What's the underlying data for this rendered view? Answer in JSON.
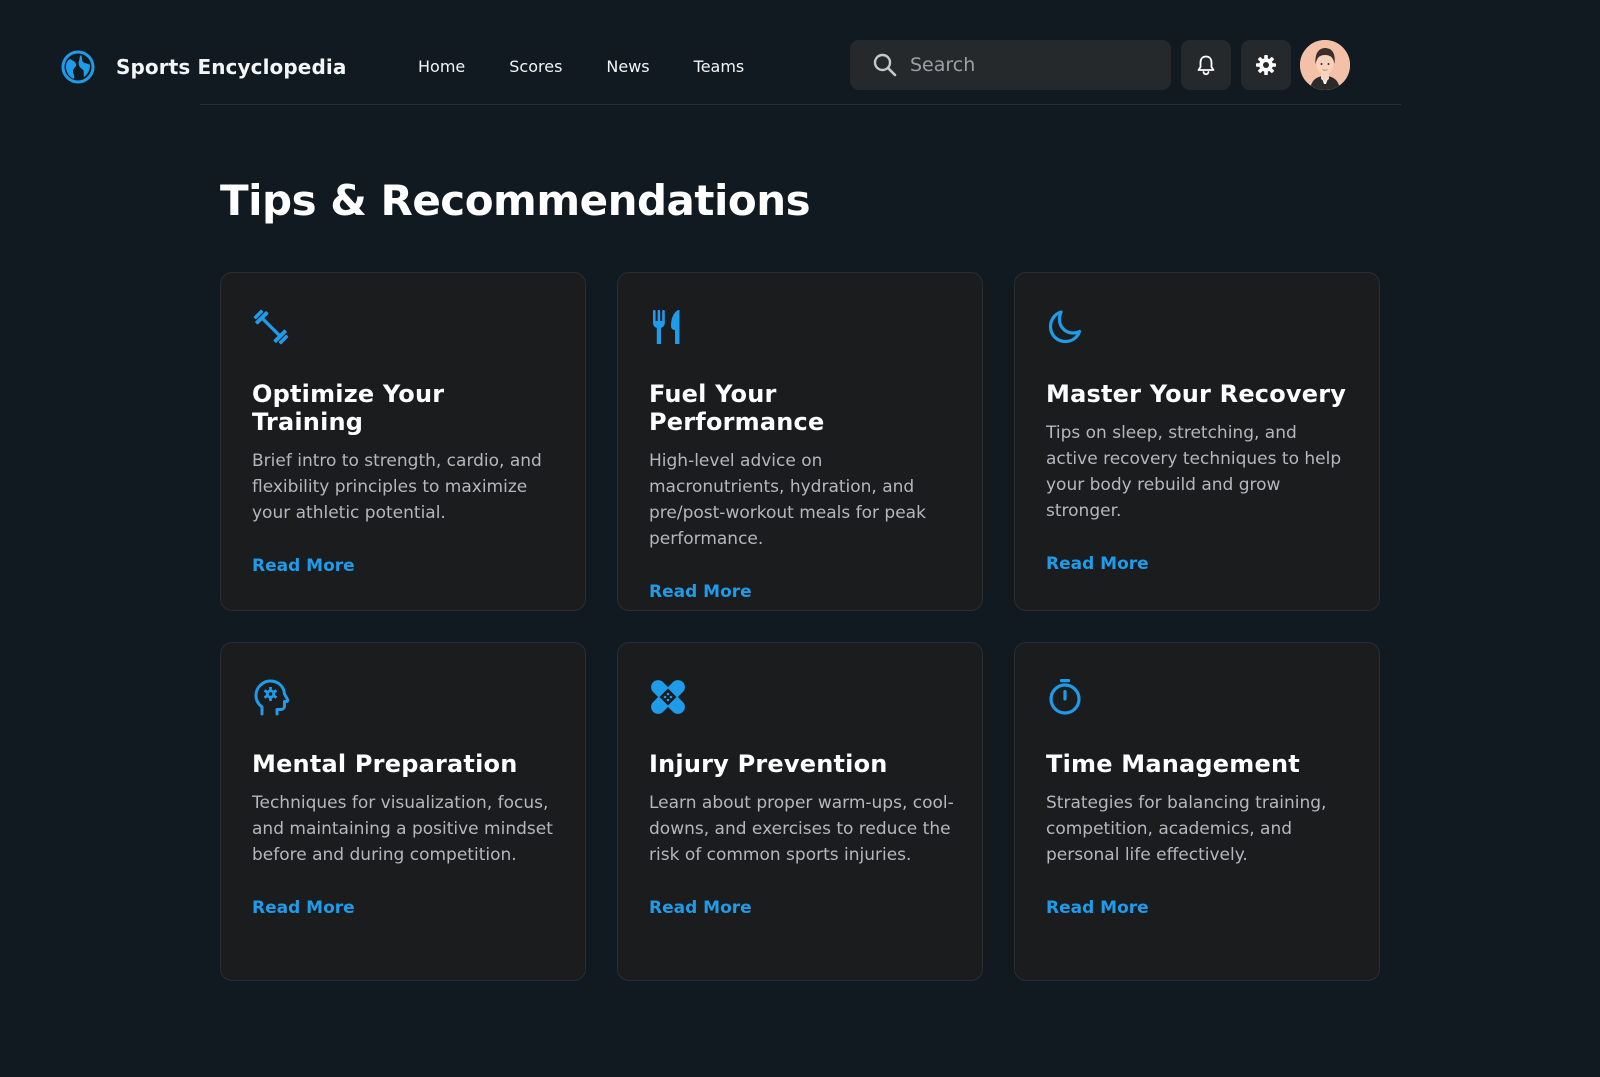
{
  "header": {
    "brand": "Sports Encyclopedia",
    "nav": [
      {
        "label": "Home"
      },
      {
        "label": "Scores"
      },
      {
        "label": "News"
      },
      {
        "label": "Teams"
      }
    ],
    "search_placeholder": "Search",
    "icons": [
      "globe-icon",
      "search-icon",
      "bell-icon",
      "gear-icon"
    ]
  },
  "page": {
    "title": "Tips & Recommendations"
  },
  "cards": [
    {
      "icon": "dumbbell-icon",
      "title": "Optimize Your Training",
      "desc": "Brief intro to strength, cardio, and flexibility principles to maximize your athletic potential.",
      "link": "Read More"
    },
    {
      "icon": "fork-knife-icon",
      "title": "Fuel Your Performance",
      "desc": "High-level advice on macronutrients, hydration, and pre/post-workout meals for peak performance.",
      "link": "Read More"
    },
    {
      "icon": "moon-icon",
      "title": "Master Your Recovery",
      "desc": "Tips on sleep, stretching, and active recovery techniques to help your body rebuild and grow stronger.",
      "link": "Read More"
    },
    {
      "icon": "brain-gear-icon",
      "title": "Mental Preparation",
      "desc": "Techniques for visualization, focus, and maintaining a positive mindset before and during competition.",
      "link": "Read More"
    },
    {
      "icon": "bandage-icon",
      "title": "Injury Prevention",
      "desc": "Learn about proper warm-ups, cool-downs, and exercises to reduce the risk of common sports injuries.",
      "link": "Read More"
    },
    {
      "icon": "stopwatch-icon",
      "title": "Time Management",
      "desc": "Strategies for balancing training, competition, academics, and personal life effectively.",
      "link": "Read More"
    }
  ],
  "colors": {
    "background": "#111a21",
    "card": "#1b1c1e",
    "accent": "#1e9be9",
    "text_muted": "#b3b8bd"
  }
}
